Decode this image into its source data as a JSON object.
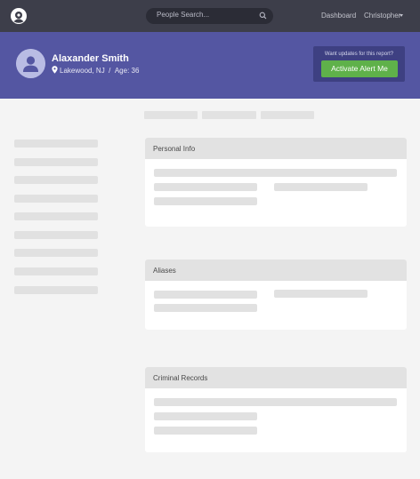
{
  "topbar": {
    "search_placeholder": "People Search...",
    "nav_dashboard": "Dashboard",
    "nav_user": "Christopher"
  },
  "profile": {
    "name": "Alaxander Smith",
    "location": "Lakewood, NJ",
    "separator": "/",
    "age": "Age: 36"
  },
  "alert": {
    "prompt": "Want updates for this report?",
    "button": "Activate Alert Me"
  },
  "sections": [
    {
      "title": "Personal Info"
    },
    {
      "title": "Aliases"
    },
    {
      "title": "Criminal Records"
    }
  ],
  "colors": {
    "topbar": "#3d3e4a",
    "header": "#5456a2",
    "alert_button": "#5fb14a"
  }
}
